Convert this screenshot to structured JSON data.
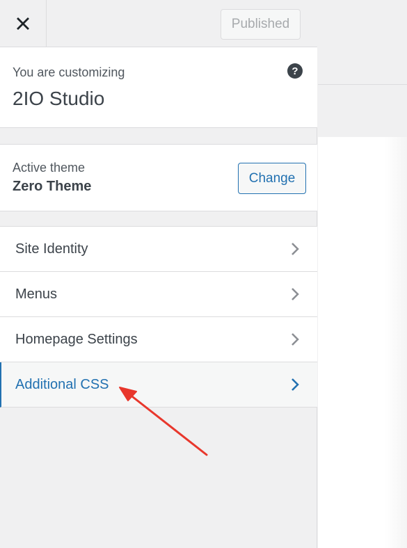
{
  "topbar": {
    "close_icon": "close-icon",
    "published_label": "Published"
  },
  "info": {
    "label": "You are customizing",
    "site_title": "2IO Studio",
    "help_icon": "help-icon",
    "help_glyph": "?"
  },
  "theme": {
    "label": "Active theme",
    "name": "Zero Theme",
    "change_label": "Change"
  },
  "menu": {
    "items": [
      {
        "label": "Site Identity"
      },
      {
        "label": "Menus"
      },
      {
        "label": "Homepage Settings"
      },
      {
        "label": "Additional CSS"
      }
    ]
  },
  "colors": {
    "accent": "#2271b1",
    "annotation_arrow": "#e8372c"
  }
}
